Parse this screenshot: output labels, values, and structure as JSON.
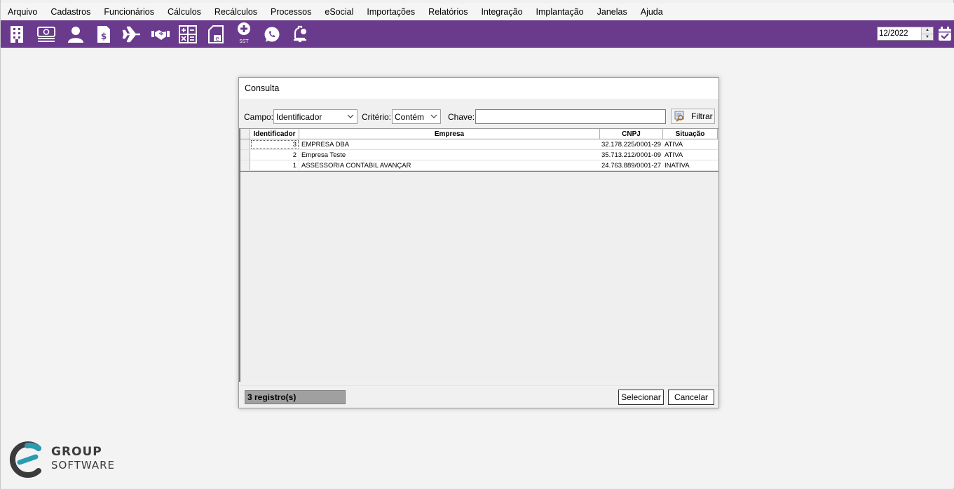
{
  "menu": [
    "Arquivo",
    "Cadastros",
    "Funcionários",
    "Cálculos",
    "Recálculos",
    "Processos",
    "eSocial",
    "Importações",
    "Relatórios",
    "Integração",
    "Implantação",
    "Janelas",
    "Ajuda"
  ],
  "toolbar": {
    "icons": [
      "building-icon",
      "money-icon",
      "user-icon",
      "receipt-icon",
      "airplane-icon",
      "handshake-icon",
      "calculator-icon",
      "document-e-icon",
      "sst-icon",
      "whatsapp-icon",
      "bell-icon"
    ],
    "sst_label": "SST",
    "period_value": "12/2022",
    "accent": "#6a3b8d"
  },
  "dialog": {
    "title": "Consulta",
    "campo_label": "Campo:",
    "campo_value": "Identificador",
    "criterio_label": "Critério:",
    "criterio_value": "Contém",
    "chave_label": "Chave:",
    "chave_value": "",
    "filter_label": "Filtrar",
    "columns": [
      "Identificador",
      "Empresa",
      "CNPJ",
      "Situação"
    ],
    "rows": [
      {
        "id": "3",
        "empresa": "EMPRESA DBA",
        "cnpj": "32.178.225/0001-29",
        "situacao": "ATIVA"
      },
      {
        "id": "2",
        "empresa": "Empresa Teste",
        "cnpj": "35.713.212/0001-09",
        "situacao": "ATIVA"
      },
      {
        "id": "1",
        "empresa": "ASSESSORIA CONTABIL AVANÇAR",
        "cnpj": "24.763.889/0001-27",
        "situacao": "INATIVA"
      }
    ],
    "record_count": "3 registro(s)",
    "select_label": "Selecionar",
    "cancel_label": "Cancelar"
  },
  "brand": {
    "line1": "GROUP",
    "line2": "SOFTWARE"
  }
}
